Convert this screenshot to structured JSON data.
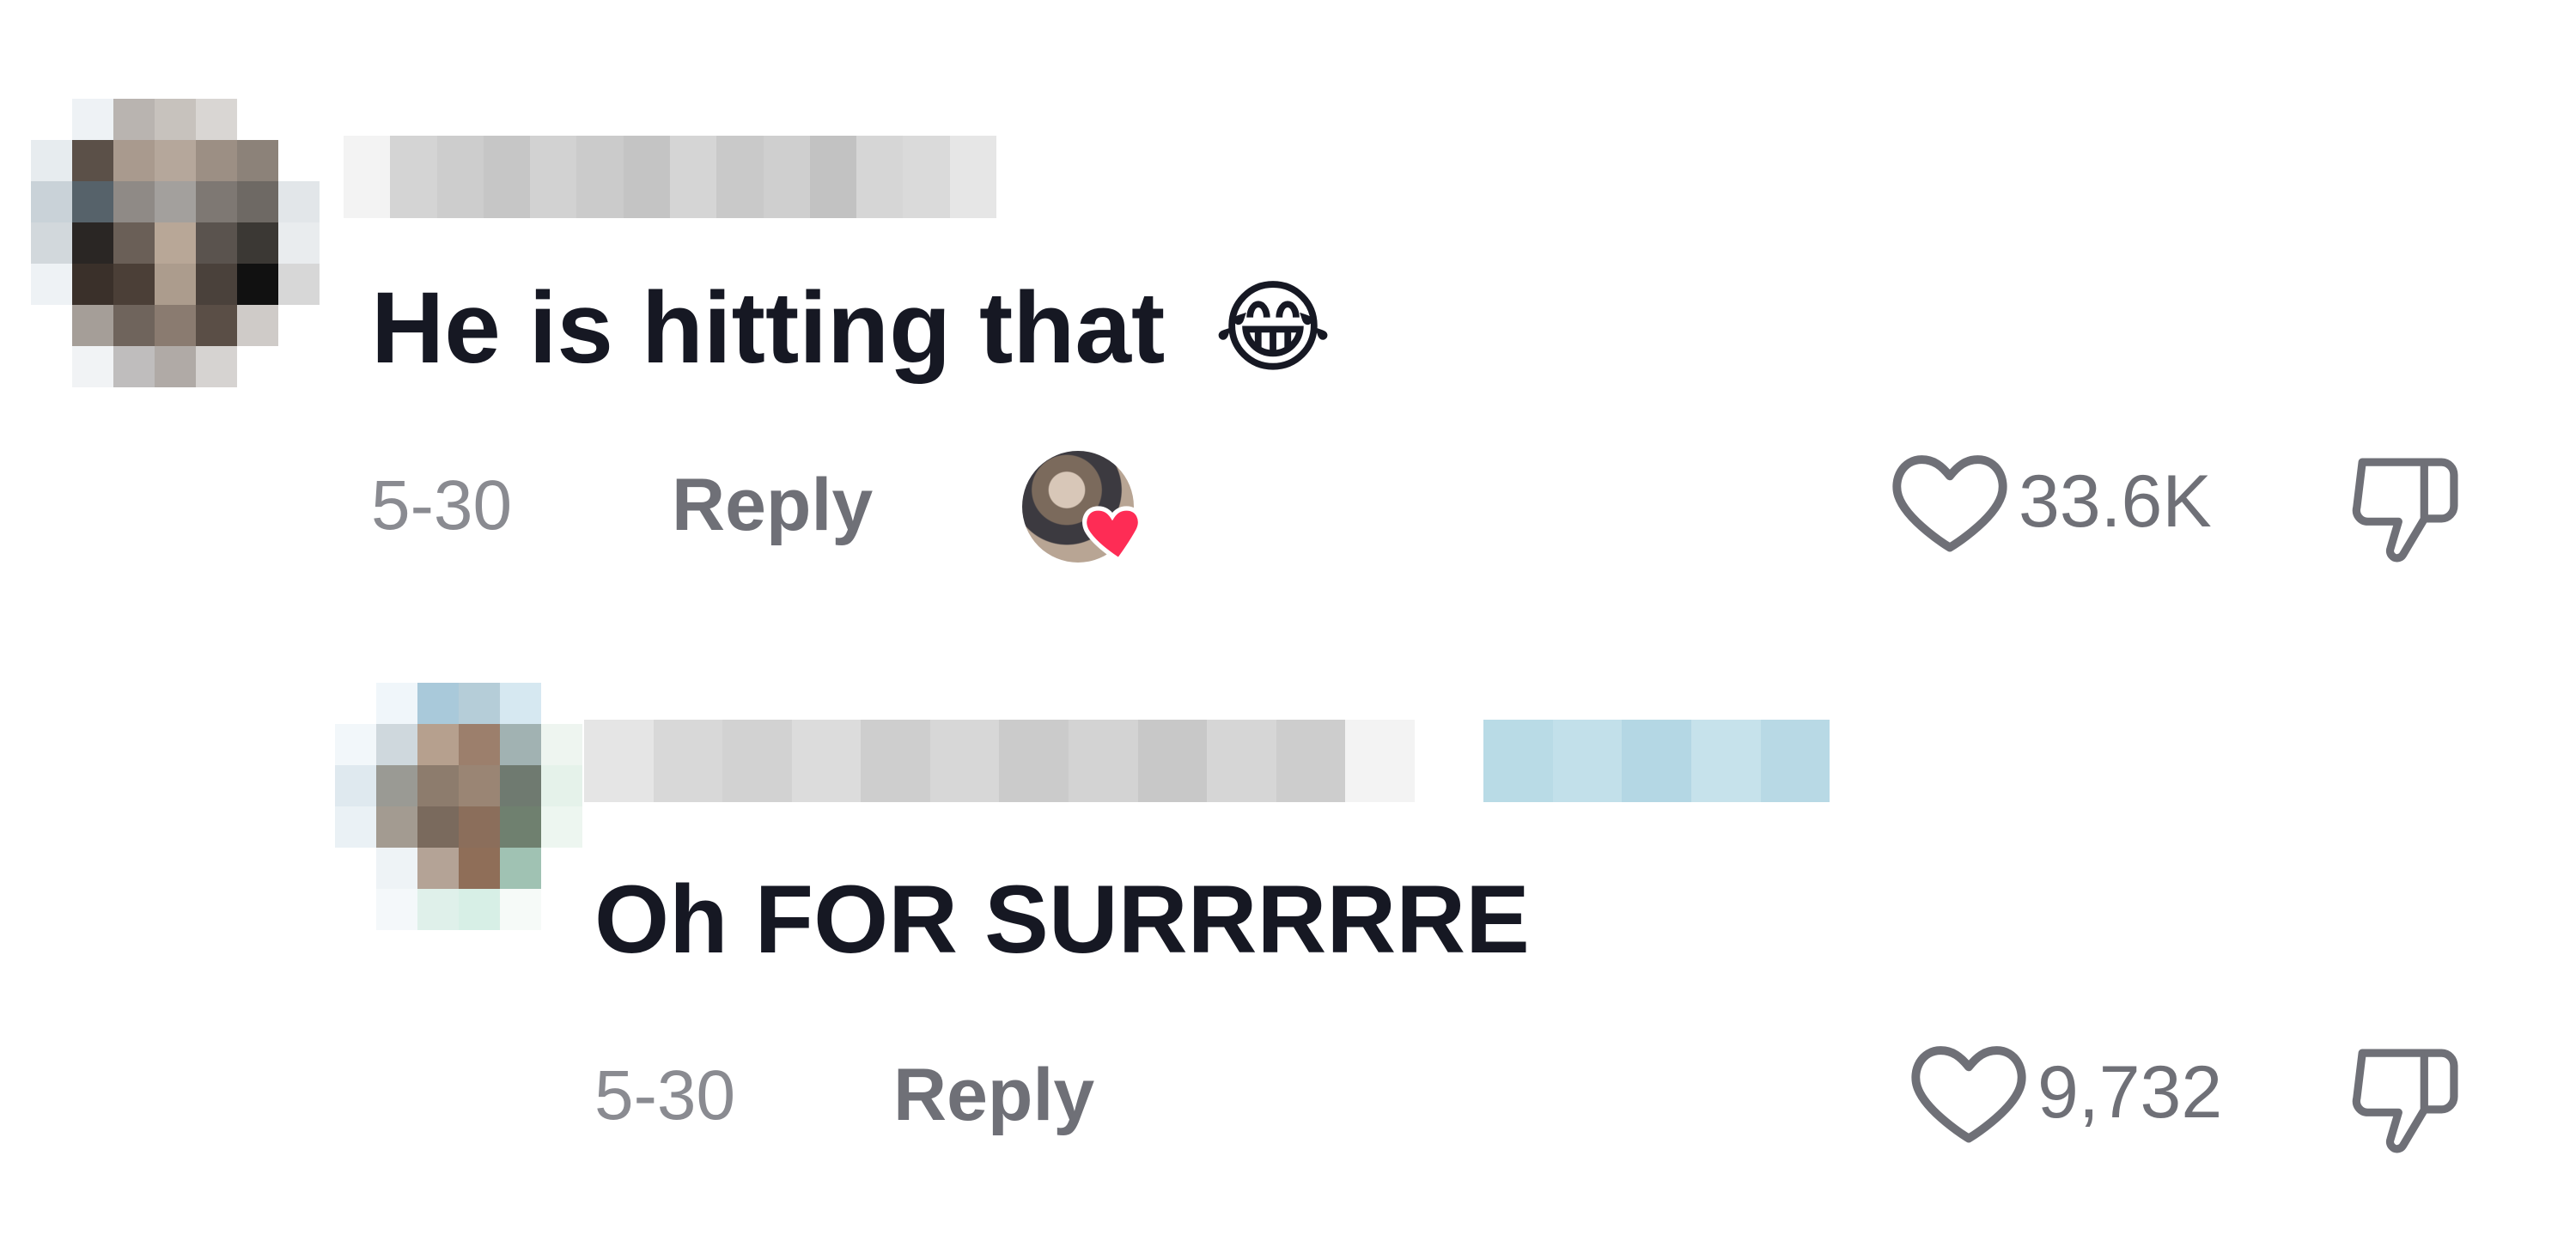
{
  "comments": [
    {
      "text": "He is hitting that",
      "emoji": "😂",
      "date": "5-30",
      "reply_label": "Reply",
      "likes": "33.6K",
      "liked_by_creator": true
    },
    {
      "text": "Oh FOR SURRRRRE",
      "date": "5-30",
      "reply_label": "Reply",
      "likes": "9,732"
    }
  ],
  "icons": {
    "like": "heart-outline-icon",
    "dislike": "thumbs-down-icon",
    "creator_heart": "heart-filled-icon"
  },
  "colors": {
    "text": "#161823",
    "meta": "#8a8b91",
    "reply": "#6f7077",
    "heart_red": "#fe2c55"
  }
}
